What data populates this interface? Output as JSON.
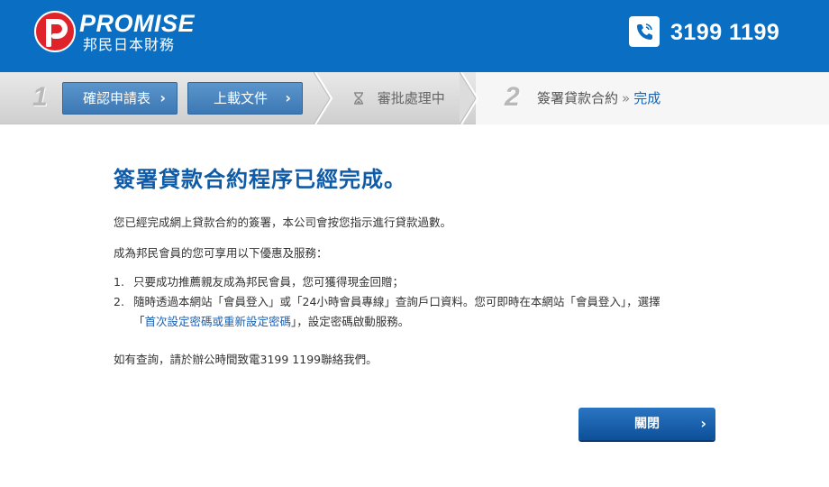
{
  "header": {
    "brand": "PROMISE",
    "brand_sub": "邦民日本財務",
    "phone": "3199 1199",
    "colors": {
      "header_bg": "#0a6fc2",
      "logo_red": "#e0232a"
    },
    "icons": {
      "logo": "promise-logo-icon",
      "phone": "phone-icon"
    }
  },
  "steps": {
    "step1_num": "1",
    "confirm_label": "確認申請表",
    "upload_label": "上載文件",
    "review_label": "審批處理中",
    "step2_num": "2",
    "sign_label": "簽署貸款合約",
    "sep": "»",
    "done_label": "完成",
    "chevron": "›"
  },
  "main": {
    "title": "簽署貸款合約程序已經完成。",
    "para1": "您已經完成網上貸款合約的簽署，本公司會按您指示進行貸款過數。",
    "para2": "成為邦民會員的您可享用以下優惠及服務：",
    "list": [
      {
        "num": "1.",
        "text": "只要成功推薦親友成為邦民會員，您可獲得現金回贈；"
      },
      {
        "num": "2.",
        "text": "隨時透過本網站「會員登入」或「24小時會員專線」查詢戶口資料。您可即時在本網站「會員登入」，選擇",
        "cont_pre": "「",
        "link": "首次設定密碼或重新設定密碼",
        "cont_post": "」，設定密碼啟動服務。"
      }
    ],
    "para3": "如有查詢，請於辦公時間致電3199 1199聯絡我們。"
  },
  "actions": {
    "close_label": "關閉",
    "chevron": "›"
  }
}
